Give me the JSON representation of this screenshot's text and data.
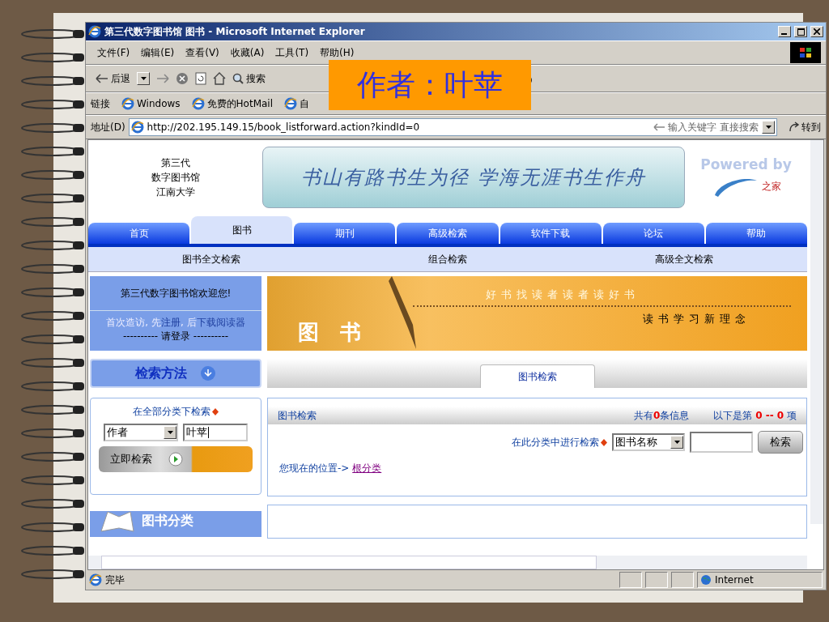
{
  "overlay_label": "作者：叶苹",
  "window": {
    "title": "第三代数字图书馆 图书 - Microsoft Internet Explorer"
  },
  "menu": [
    "文件(F)",
    "编辑(E)",
    "查看(V)",
    "收藏(A)",
    "工具(T)",
    "帮助(H)"
  ],
  "toolbar": {
    "back": "后退",
    "search": "搜索"
  },
  "links_bar": {
    "label": "链接",
    "links": [
      "Windows",
      "免费的HotMail",
      "自"
    ]
  },
  "address_bar": {
    "label": "地址(D)",
    "url": "http://202.195.149.15/book_listforward.action?kindId=0",
    "search_hint": "输入关键字 直接搜索",
    "go": "转到"
  },
  "site_header": {
    "library_name": [
      "第三代",
      "数字图书馆",
      "江南大学"
    ],
    "slogan": "书山有路书生为径 学海无涯书生作舟",
    "powered_by": "Powered by",
    "logo_text": "之家"
  },
  "nav_tabs": [
    {
      "label": "首页",
      "selected": false
    },
    {
      "label": "图书",
      "selected": true
    },
    {
      "label": "期刊",
      "selected": false
    },
    {
      "label": "高级检索",
      "selected": false
    },
    {
      "label": "软件下载",
      "selected": false
    },
    {
      "label": "论坛",
      "selected": false
    },
    {
      "label": "帮助",
      "selected": false
    }
  ],
  "sub_nav": [
    "图书全文检索",
    "组合检索",
    "高级全文检索"
  ],
  "welcome": {
    "title": "第三代数字图书馆欢迎您!",
    "intro": [
      {
        "kind": "text",
        "text": "首次造访, 先"
      },
      {
        "kind": "link",
        "text": "注册"
      },
      {
        "kind": "text",
        "text": ", 后"
      },
      {
        "kind": "link",
        "text": "下载阅读器"
      }
    ],
    "login": "---------- 请登录 ----------"
  },
  "book_banner": {
    "motto": "好书找读者读者读好书",
    "tagline": "读书学习新理念",
    "title": "图　书"
  },
  "search_method": {
    "label": "检索方法",
    "tab": "图书检索"
  },
  "quick_search": {
    "title": "在全部分类下检索",
    "field": "作者",
    "value": "叶苹",
    "button": "立即检索"
  },
  "results": {
    "title": "图书检索",
    "count": "共有**0**条信息",
    "range": "以下是第 **0 -- 0** 项",
    "category_search": "在此分类中进行检索",
    "field": "图书名称",
    "button": "检索",
    "location": "您现在的位置->",
    "location_link": "根分类"
  },
  "category": {
    "title": "图书分类"
  },
  "status_bar": {
    "text": "完毕",
    "zone": "Internet"
  }
}
